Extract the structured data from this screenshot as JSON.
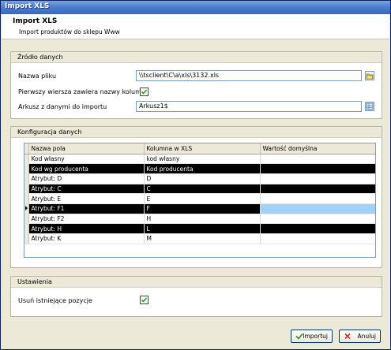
{
  "window": {
    "title": "Import XLS"
  },
  "header": {
    "title": "Import XLS",
    "subtitle": "Import produktów do sklepu Www"
  },
  "source": {
    "section_label": "Źródło danych",
    "file_label": "Nazwa pliku",
    "file_value": "\\\\tsclient\\C\\a\\xls\\3132.xls",
    "first_row_label": "Pierwszy wiersza zawiera nazwy kolumn",
    "first_row_checked": true,
    "sheet_label": "Arkusz z danymi do importu",
    "sheet_value": "Arkusz1$"
  },
  "config": {
    "section_label": "Konfiguracja danych",
    "columns": [
      "Nazwa pola",
      "Kolumna w XLS",
      "Wartość domyślna"
    ],
    "rows": [
      {
        "name": "Kod własny",
        "column": "kod własny",
        "default": "",
        "style": "normal"
      },
      {
        "name": "Kod wg producenta",
        "column": "Kod producenta",
        "default": "",
        "style": "dark"
      },
      {
        "name": "Atrybut: D",
        "column": "D",
        "default": "",
        "style": "normal"
      },
      {
        "name": "Atrybut: C",
        "column": "C",
        "default": "",
        "style": "dark"
      },
      {
        "name": "Atrybut: E",
        "column": "E",
        "default": "",
        "style": "normal"
      },
      {
        "name": "Atrybut: F1",
        "column": "F",
        "default": "",
        "style": "selected"
      },
      {
        "name": "Atrybut: F2",
        "column": "H",
        "default": "",
        "style": "normal"
      },
      {
        "name": "Atrybut: H",
        "column": "L",
        "default": "",
        "style": "dark"
      },
      {
        "name": "Atrybut: K",
        "column": "M",
        "default": "",
        "style": "normal"
      }
    ]
  },
  "settings": {
    "section_label": "Ustawienia",
    "remove_label": "Usuń istniejące pozycje",
    "remove_checked": true
  },
  "footer": {
    "import_label": "Importuj",
    "cancel_label": "Anuluj"
  },
  "colors": {
    "title_bar": "#3568c0",
    "selection": "#9fd2fb",
    "window_bg": "#ece9d8"
  },
  "icons": {
    "file_browse": "open-folder-icon",
    "sheet_pick": "sheet-select-icon",
    "import": "import-icon",
    "cancel": "cancel-icon"
  }
}
